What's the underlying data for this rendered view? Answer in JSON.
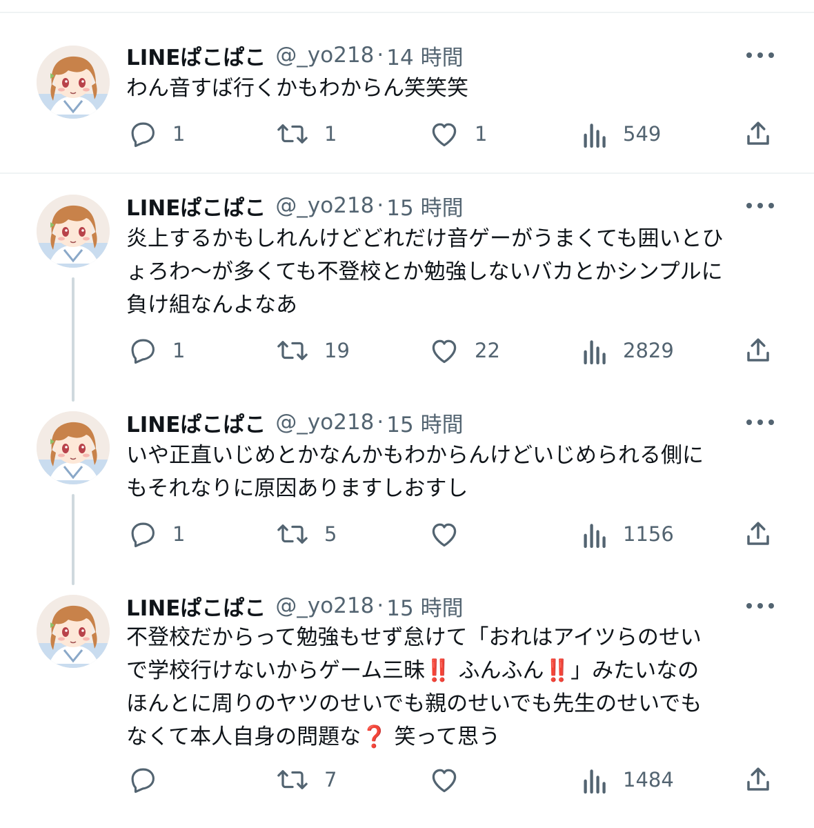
{
  "tweets": [
    {
      "name": "LINEぱこぱこ",
      "handle": "@_yo218",
      "separator": "·",
      "time": "14 時間",
      "lines": [
        "わん音すば行くかもわからん笑笑笑"
      ],
      "reply_count": "1",
      "retweet_count": "1",
      "like_count": "1",
      "view_count": "549"
    },
    {
      "name": "LINEぱこぱこ",
      "handle": "@_yo218",
      "separator": "·",
      "time": "15 時間",
      "lines": [
        "炎上するかもしれんけどどれだけ音ゲーがうまくても囲いとひ",
        "ょろわ〜が多くても不登校とか勉強しないバカとかシンプルに",
        "負け組なんよなあ"
      ],
      "reply_count": "1",
      "retweet_count": "19",
      "like_count": "22",
      "view_count": "2829"
    },
    {
      "name": "LINEぱこぱこ",
      "handle": "@_yo218",
      "separator": "·",
      "time": "15 時間",
      "lines": [
        "いや正直いじめとかなんかもわからんけどいじめられる側に",
        "もそれなりに原因ありますしおすし"
      ],
      "reply_count": "1",
      "retweet_count": "5",
      "like_count": "",
      "view_count": "1156"
    },
    {
      "name": "LINEぱこぱこ",
      "handle": "@_yo218",
      "separator": "·",
      "time": "15 時間",
      "lines": [
        "不登校だからって勉強もせず怠けて「おれはアイツらのせい",
        "で学校行けないからゲーム三昧‼️ ふんふん‼️」みたいなの",
        "ほんとに周りのヤツのせいでも親のせいでも先生のせいでも",
        "なくて本人自身の問題な❓ 笑って思う"
      ],
      "reply_count": "",
      "retweet_count": "7",
      "like_count": "",
      "view_count": "1484"
    }
  ],
  "icons": {
    "reply": "reply-icon",
    "retweet": "retweet-icon",
    "like": "heart-icon",
    "views": "views-icon",
    "share": "share-icon",
    "more": "more-dots-icon"
  },
  "colors": {
    "text": "#0f1419",
    "secondary": "#536471",
    "divider": "#eff3f4",
    "thread": "#cfd9de"
  }
}
